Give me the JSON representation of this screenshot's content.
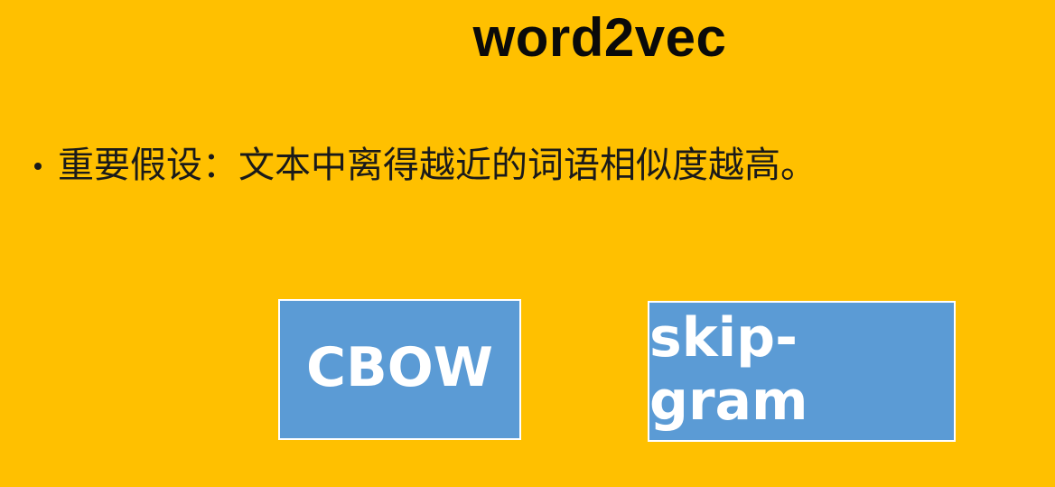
{
  "slide": {
    "title": "word2vec",
    "bullet": "重要假设：文本中离得越近的词语相似度越高。",
    "boxes": {
      "cbow_label": "CBOW",
      "skip_gram_label": "skip-gram"
    },
    "colors": {
      "background": "#ffc000",
      "box_fill": "#5b9bd5",
      "box_border": "#ffffff",
      "box_text": "#ffffff",
      "title_text": "#0a0a0a"
    }
  }
}
